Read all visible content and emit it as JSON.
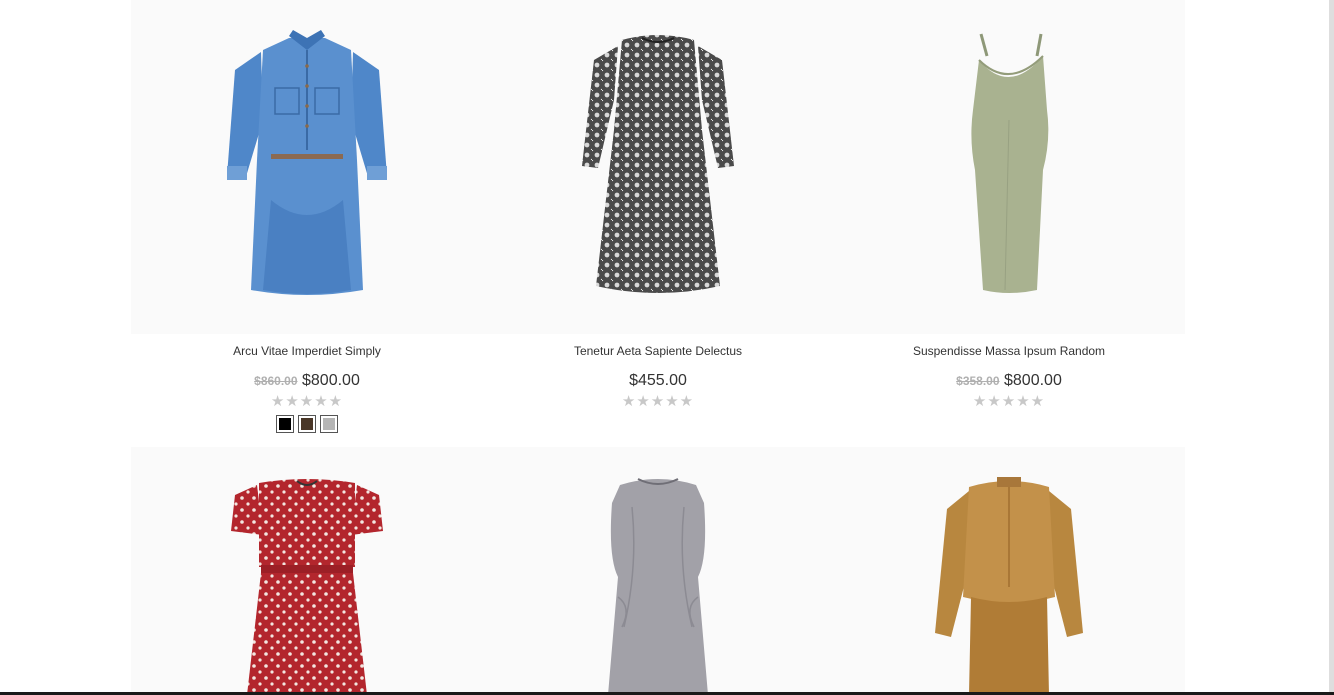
{
  "products": [
    {
      "name": "Arcu Vitae Imperdiet Simply",
      "old_price": "$860.00",
      "price": "$800.00",
      "rating_stars": "★★★★★",
      "rating_value": 0,
      "swatches": [
        "#000000",
        "#4a3728",
        "#b5b5b5"
      ],
      "image_color": "#4a7fc1"
    },
    {
      "name": "Tenetur Aeta Sapiente Delectus",
      "old_price": "",
      "price": "$455.00",
      "rating_stars": "★★★★★",
      "rating_value": 0,
      "swatches": [],
      "image_color": "#6b6b6b"
    },
    {
      "name": "Suspendisse Massa Ipsum Random",
      "old_price": "$358.00",
      "price": "$800.00",
      "rating_stars": "★★★★★",
      "rating_value": 0,
      "swatches": [],
      "image_color": "#a3ad88"
    },
    {
      "name": "",
      "price": "",
      "image_color": "#b3262d"
    },
    {
      "name": "",
      "price": "",
      "image_color": "#9a9a9e"
    },
    {
      "name": "",
      "price": "",
      "image_color": "#b8873f"
    }
  ],
  "colors": {
    "star_empty": "#c8c8c8",
    "old_price": "#b0b0b0",
    "text": "#333333"
  }
}
